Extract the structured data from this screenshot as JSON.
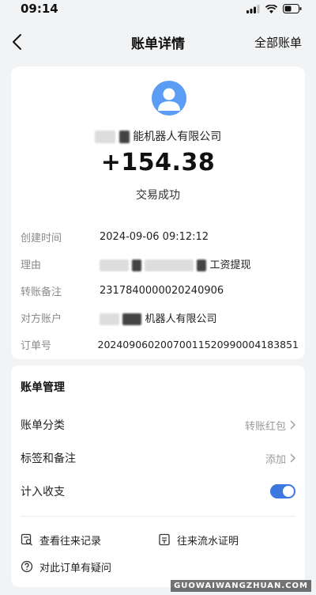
{
  "status_bar": {
    "time": "09:14"
  },
  "nav": {
    "title": "账单详情",
    "right_link": "全部账单"
  },
  "transaction": {
    "merchant_visible": "能机器人有限公司",
    "amount": "+154.38",
    "status": "交易成功"
  },
  "details": [
    {
      "label": "创建时间",
      "value": "2024-09-06 09:12:12"
    },
    {
      "label": "理由",
      "value": "工资提现"
    },
    {
      "label": "转账备注",
      "value": "2317840000020240906"
    },
    {
      "label": "对方账户",
      "value": "机器人有限公司"
    },
    {
      "label": "订单号",
      "value": "20240906020070011520990004183851"
    }
  ],
  "manage": {
    "title": "账单管理",
    "category_label": "账单分类",
    "category_value": "转账红包",
    "tags_label": "标签和备注",
    "tags_value": "添加",
    "income_label": "计入收支",
    "income_enabled": true
  },
  "actions": {
    "history": "查看往来记录",
    "proof": "往来流水证明",
    "question": "对此订单有疑问"
  },
  "watermark": "GUOWAIWANGZHUAN.COM",
  "colors": {
    "accent": "#3d77e0",
    "avatar": "#5b9cf4"
  }
}
